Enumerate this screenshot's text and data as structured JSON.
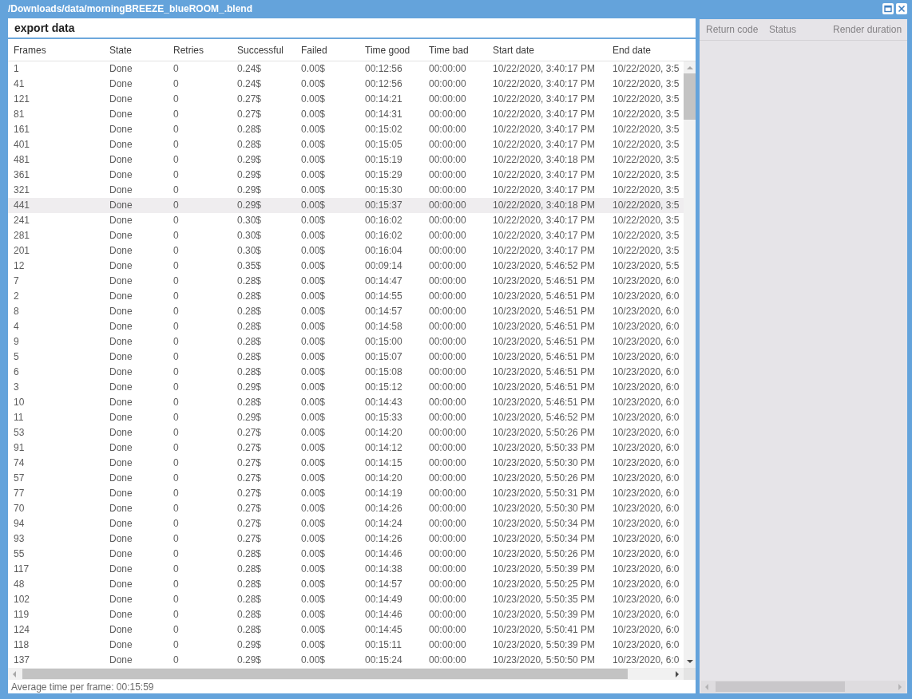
{
  "window": {
    "title": "/Downloads/data/morningBREEZE_blueROOM_.blend"
  },
  "export_panel": {
    "title": "export data",
    "table": {
      "columns": [
        "Frames",
        "State",
        "Retries",
        "Successful",
        "Failed",
        "Time good",
        "Time bad",
        "Start date",
        "End date"
      ],
      "rows": [
        {
          "cells": [
            "1",
            "Done",
            "0",
            "0.24$",
            "0.00$",
            "00:12:56",
            "00:00:00",
            "10/22/2020, 3:40:17 PM",
            "10/22/2020, 3:5"
          ],
          "selected": false
        },
        {
          "cells": [
            "41",
            "Done",
            "0",
            "0.24$",
            "0.00$",
            "00:12:56",
            "00:00:00",
            "10/22/2020, 3:40:17 PM",
            "10/22/2020, 3:5"
          ],
          "selected": false
        },
        {
          "cells": [
            "121",
            "Done",
            "0",
            "0.27$",
            "0.00$",
            "00:14:21",
            "00:00:00",
            "10/22/2020, 3:40:17 PM",
            "10/22/2020, 3:5"
          ],
          "selected": false
        },
        {
          "cells": [
            "81",
            "Done",
            "0",
            "0.27$",
            "0.00$",
            "00:14:31",
            "00:00:00",
            "10/22/2020, 3:40:17 PM",
            "10/22/2020, 3:5"
          ],
          "selected": false
        },
        {
          "cells": [
            "161",
            "Done",
            "0",
            "0.28$",
            "0.00$",
            "00:15:02",
            "00:00:00",
            "10/22/2020, 3:40:17 PM",
            "10/22/2020, 3:5"
          ],
          "selected": false
        },
        {
          "cells": [
            "401",
            "Done",
            "0",
            "0.28$",
            "0.00$",
            "00:15:05",
            "00:00:00",
            "10/22/2020, 3:40:17 PM",
            "10/22/2020, 3:5"
          ],
          "selected": false
        },
        {
          "cells": [
            "481",
            "Done",
            "0",
            "0.29$",
            "0.00$",
            "00:15:19",
            "00:00:00",
            "10/22/2020, 3:40:18 PM",
            "10/22/2020, 3:5"
          ],
          "selected": false
        },
        {
          "cells": [
            "361",
            "Done",
            "0",
            "0.29$",
            "0.00$",
            "00:15:29",
            "00:00:00",
            "10/22/2020, 3:40:17 PM",
            "10/22/2020, 3:5"
          ],
          "selected": false
        },
        {
          "cells": [
            "321",
            "Done",
            "0",
            "0.29$",
            "0.00$",
            "00:15:30",
            "00:00:00",
            "10/22/2020, 3:40:17 PM",
            "10/22/2020, 3:5"
          ],
          "selected": false
        },
        {
          "cells": [
            "441",
            "Done",
            "0",
            "0.29$",
            "0.00$",
            "00:15:37",
            "00:00:00",
            "10/22/2020, 3:40:18 PM",
            "10/22/2020, 3:5"
          ],
          "selected": true
        },
        {
          "cells": [
            "241",
            "Done",
            "0",
            "0.30$",
            "0.00$",
            "00:16:02",
            "00:00:00",
            "10/22/2020, 3:40:17 PM",
            "10/22/2020, 3:5"
          ],
          "selected": false
        },
        {
          "cells": [
            "281",
            "Done",
            "0",
            "0.30$",
            "0.00$",
            "00:16:02",
            "00:00:00",
            "10/22/2020, 3:40:17 PM",
            "10/22/2020, 3:5"
          ],
          "selected": false
        },
        {
          "cells": [
            "201",
            "Done",
            "0",
            "0.30$",
            "0.00$",
            "00:16:04",
            "00:00:00",
            "10/22/2020, 3:40:17 PM",
            "10/22/2020, 3:5"
          ],
          "selected": false
        },
        {
          "cells": [
            "12",
            "Done",
            "0",
            "0.35$",
            "0.00$",
            "00:09:14",
            "00:00:00",
            "10/23/2020, 5:46:52 PM",
            "10/23/2020, 5:5"
          ],
          "selected": false
        },
        {
          "cells": [
            "7",
            "Done",
            "0",
            "0.28$",
            "0.00$",
            "00:14:47",
            "00:00:00",
            "10/23/2020, 5:46:51 PM",
            "10/23/2020, 6:0"
          ],
          "selected": false
        },
        {
          "cells": [
            "2",
            "Done",
            "0",
            "0.28$",
            "0.00$",
            "00:14:55",
            "00:00:00",
            "10/23/2020, 5:46:51 PM",
            "10/23/2020, 6:0"
          ],
          "selected": false
        },
        {
          "cells": [
            "8",
            "Done",
            "0",
            "0.28$",
            "0.00$",
            "00:14:57",
            "00:00:00",
            "10/23/2020, 5:46:51 PM",
            "10/23/2020, 6:0"
          ],
          "selected": false
        },
        {
          "cells": [
            "4",
            "Done",
            "0",
            "0.28$",
            "0.00$",
            "00:14:58",
            "00:00:00",
            "10/23/2020, 5:46:51 PM",
            "10/23/2020, 6:0"
          ],
          "selected": false
        },
        {
          "cells": [
            "9",
            "Done",
            "0",
            "0.28$",
            "0.00$",
            "00:15:00",
            "00:00:00",
            "10/23/2020, 5:46:51 PM",
            "10/23/2020, 6:0"
          ],
          "selected": false
        },
        {
          "cells": [
            "5",
            "Done",
            "0",
            "0.28$",
            "0.00$",
            "00:15:07",
            "00:00:00",
            "10/23/2020, 5:46:51 PM",
            "10/23/2020, 6:0"
          ],
          "selected": false
        },
        {
          "cells": [
            "6",
            "Done",
            "0",
            "0.28$",
            "0.00$",
            "00:15:08",
            "00:00:00",
            "10/23/2020, 5:46:51 PM",
            "10/23/2020, 6:0"
          ],
          "selected": false
        },
        {
          "cells": [
            "3",
            "Done",
            "0",
            "0.29$",
            "0.00$",
            "00:15:12",
            "00:00:00",
            "10/23/2020, 5:46:51 PM",
            "10/23/2020, 6:0"
          ],
          "selected": false
        },
        {
          "cells": [
            "10",
            "Done",
            "0",
            "0.28$",
            "0.00$",
            "00:14:43",
            "00:00:00",
            "10/23/2020, 5:46:51 PM",
            "10/23/2020, 6:0"
          ],
          "selected": false
        },
        {
          "cells": [
            "11",
            "Done",
            "0",
            "0.29$",
            "0.00$",
            "00:15:33",
            "00:00:00",
            "10/23/2020, 5:46:52 PM",
            "10/23/2020, 6:0"
          ],
          "selected": false
        },
        {
          "cells": [
            "53",
            "Done",
            "0",
            "0.27$",
            "0.00$",
            "00:14:20",
            "00:00:00",
            "10/23/2020, 5:50:26 PM",
            "10/23/2020, 6:0"
          ],
          "selected": false
        },
        {
          "cells": [
            "91",
            "Done",
            "0",
            "0.27$",
            "0.00$",
            "00:14:12",
            "00:00:00",
            "10/23/2020, 5:50:33 PM",
            "10/23/2020, 6:0"
          ],
          "selected": false
        },
        {
          "cells": [
            "74",
            "Done",
            "0",
            "0.27$",
            "0.00$",
            "00:14:15",
            "00:00:00",
            "10/23/2020, 5:50:30 PM",
            "10/23/2020, 6:0"
          ],
          "selected": false
        },
        {
          "cells": [
            "57",
            "Done",
            "0",
            "0.27$",
            "0.00$",
            "00:14:20",
            "00:00:00",
            "10/23/2020, 5:50:26 PM",
            "10/23/2020, 6:0"
          ],
          "selected": false
        },
        {
          "cells": [
            "77",
            "Done",
            "0",
            "0.27$",
            "0.00$",
            "00:14:19",
            "00:00:00",
            "10/23/2020, 5:50:31 PM",
            "10/23/2020, 6:0"
          ],
          "selected": false
        },
        {
          "cells": [
            "70",
            "Done",
            "0",
            "0.27$",
            "0.00$",
            "00:14:26",
            "00:00:00",
            "10/23/2020, 5:50:30 PM",
            "10/23/2020, 6:0"
          ],
          "selected": false
        },
        {
          "cells": [
            "94",
            "Done",
            "0",
            "0.27$",
            "0.00$",
            "00:14:24",
            "00:00:00",
            "10/23/2020, 5:50:34 PM",
            "10/23/2020, 6:0"
          ],
          "selected": false
        },
        {
          "cells": [
            "93",
            "Done",
            "0",
            "0.27$",
            "0.00$",
            "00:14:26",
            "00:00:00",
            "10/23/2020, 5:50:34 PM",
            "10/23/2020, 6:0"
          ],
          "selected": false
        },
        {
          "cells": [
            "55",
            "Done",
            "0",
            "0.28$",
            "0.00$",
            "00:14:46",
            "00:00:00",
            "10/23/2020, 5:50:26 PM",
            "10/23/2020, 6:0"
          ],
          "selected": false
        },
        {
          "cells": [
            "117",
            "Done",
            "0",
            "0.28$",
            "0.00$",
            "00:14:38",
            "00:00:00",
            "10/23/2020, 5:50:39 PM",
            "10/23/2020, 6:0"
          ],
          "selected": false
        },
        {
          "cells": [
            "48",
            "Done",
            "0",
            "0.28$",
            "0.00$",
            "00:14:57",
            "00:00:00",
            "10/23/2020, 5:50:25 PM",
            "10/23/2020, 6:0"
          ],
          "selected": false
        },
        {
          "cells": [
            "102",
            "Done",
            "0",
            "0.28$",
            "0.00$",
            "00:14:49",
            "00:00:00",
            "10/23/2020, 5:50:35 PM",
            "10/23/2020, 6:0"
          ],
          "selected": false
        },
        {
          "cells": [
            "119",
            "Done",
            "0",
            "0.28$",
            "0.00$",
            "00:14:46",
            "00:00:00",
            "10/23/2020, 5:50:39 PM",
            "10/23/2020, 6:0"
          ],
          "selected": false
        },
        {
          "cells": [
            "124",
            "Done",
            "0",
            "0.28$",
            "0.00$",
            "00:14:45",
            "00:00:00",
            "10/23/2020, 5:50:41 PM",
            "10/23/2020, 6:0"
          ],
          "selected": false
        },
        {
          "cells": [
            "118",
            "Done",
            "0",
            "0.29$",
            "0.00$",
            "00:15:11",
            "00:00:00",
            "10/23/2020, 5:50:39 PM",
            "10/23/2020, 6:0"
          ],
          "selected": false
        },
        {
          "cells": [
            "137",
            "Done",
            "0",
            "0.29$",
            "0.00$",
            "00:15:24",
            "00:00:00",
            "10/23/2020, 5:50:50 PM",
            "10/23/2020, 6:0"
          ],
          "selected": false
        }
      ]
    },
    "footer": "Average time per frame: 00:15:59"
  },
  "side_panel": {
    "columns": [
      "Return code",
      "Status",
      "Render duration"
    ]
  }
}
